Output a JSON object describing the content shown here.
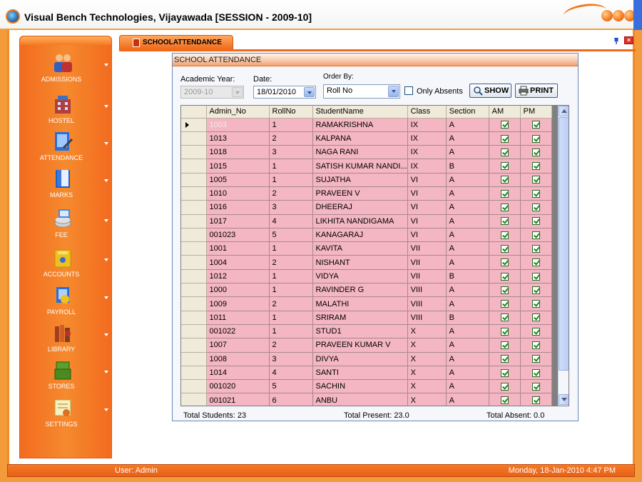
{
  "window": {
    "title": "Visual Bench Technologies, Vijayawada [SESSION - 2009-10]"
  },
  "sidebar": {
    "items": [
      {
        "label": "ADMISSIONS",
        "icon": "people-icon"
      },
      {
        "label": "HOSTEL",
        "icon": "building-icon"
      },
      {
        "label": "ATTENDANCE",
        "icon": "attendance-icon"
      },
      {
        "label": "MARKS",
        "icon": "book-icon"
      },
      {
        "label": "FEE",
        "icon": "coins-icon"
      },
      {
        "label": "ACCOUNTS",
        "icon": "ledger-icon"
      },
      {
        "label": "PAYROLL",
        "icon": "payroll-icon"
      },
      {
        "label": "LIBRARY",
        "icon": "library-icon"
      },
      {
        "label": "STORES",
        "icon": "stores-icon"
      },
      {
        "label": "SETTINGS",
        "icon": "settings-icon"
      }
    ]
  },
  "tab": {
    "label": "SCHOOLATTENDANCE"
  },
  "panel": {
    "header": "SCHOOL ATTENDANCE",
    "filters": {
      "academic_year_label": "Academic Year:",
      "academic_year_value": "2009-10",
      "date_label": "Date:",
      "date_value": "18/01/2010",
      "order_by_label": "Order By:",
      "order_by_value": "Roll No",
      "only_absents_label": "Only Absents"
    },
    "buttons": {
      "show": "SHOW",
      "print": "PRINT"
    },
    "grid": {
      "columns": [
        "Admin_No",
        "RollNo",
        "StudentName",
        "Class",
        "Section",
        "AM",
        "PM"
      ],
      "rows": [
        {
          "admin_no": "1003",
          "roll": "1",
          "name": "RAMAKRISHNA",
          "class": "IX",
          "section": "A",
          "am": true,
          "pm": true
        },
        {
          "admin_no": "1013",
          "roll": "2",
          "name": "KALPANA",
          "class": "IX",
          "section": "A",
          "am": true,
          "pm": true
        },
        {
          "admin_no": "1018",
          "roll": "3",
          "name": "NAGA RANI",
          "class": "IX",
          "section": "A",
          "am": true,
          "pm": true
        },
        {
          "admin_no": "1015",
          "roll": "1",
          "name": "SATISH KUMAR NANDI...",
          "class": "IX",
          "section": "B",
          "am": true,
          "pm": true
        },
        {
          "admin_no": "1005",
          "roll": "1",
          "name": "SUJATHA",
          "class": "VI",
          "section": "A",
          "am": true,
          "pm": true
        },
        {
          "admin_no": "1010",
          "roll": "2",
          "name": "PRAVEEN  V",
          "class": "VI",
          "section": "A",
          "am": true,
          "pm": true
        },
        {
          "admin_no": "1016",
          "roll": "3",
          "name": "DHEERAJ",
          "class": "VI",
          "section": "A",
          "am": true,
          "pm": true
        },
        {
          "admin_no": "1017",
          "roll": "4",
          "name": "LIKHITA  NANDIGAMA",
          "class": "VI",
          "section": "A",
          "am": true,
          "pm": true
        },
        {
          "admin_no": "001023",
          "roll": "5",
          "name": "KANAGARAJ",
          "class": "VI",
          "section": "A",
          "am": true,
          "pm": true
        },
        {
          "admin_no": "1001",
          "roll": "1",
          "name": "KAVITA",
          "class": "VII",
          "section": "A",
          "am": true,
          "pm": true
        },
        {
          "admin_no": "1004",
          "roll": "2",
          "name": "NISHANT",
          "class": "VII",
          "section": "A",
          "am": true,
          "pm": true
        },
        {
          "admin_no": "1012",
          "roll": "1",
          "name": "VIDYA",
          "class": "VII",
          "section": "B",
          "am": true,
          "pm": true
        },
        {
          "admin_no": "1000",
          "roll": "1",
          "name": "RAVINDER  G",
          "class": "VIII",
          "section": "A",
          "am": true,
          "pm": true
        },
        {
          "admin_no": "1009",
          "roll": "2",
          "name": "MALATHI",
          "class": "VIII",
          "section": "A",
          "am": true,
          "pm": true
        },
        {
          "admin_no": "1011",
          "roll": "1",
          "name": "SRIRAM",
          "class": "VIII",
          "section": "B",
          "am": true,
          "pm": true
        },
        {
          "admin_no": "001022",
          "roll": "1",
          "name": "STUD1",
          "class": "X",
          "section": "A",
          "am": true,
          "pm": true
        },
        {
          "admin_no": "1007",
          "roll": "2",
          "name": "PRAVEEN KUMAR V",
          "class": "X",
          "section": "A",
          "am": true,
          "pm": true
        },
        {
          "admin_no": "1008",
          "roll": "3",
          "name": "DIVYA",
          "class": "X",
          "section": "A",
          "am": true,
          "pm": true
        },
        {
          "admin_no": "1014",
          "roll": "4",
          "name": "SANTI",
          "class": "X",
          "section": "A",
          "am": true,
          "pm": true
        },
        {
          "admin_no": "001020",
          "roll": "5",
          "name": "SACHIN",
          "class": "X",
          "section": "A",
          "am": true,
          "pm": true
        },
        {
          "admin_no": "001021",
          "roll": "6",
          "name": "ANBU",
          "class": "X",
          "section": "A",
          "am": true,
          "pm": true
        }
      ]
    },
    "totals": {
      "students": "Total Students: 23",
      "present": "Total Present: 23.0",
      "absent": "Total Absent: 0.0"
    }
  },
  "statusbar": {
    "user": "User: Admin",
    "datetime": "Monday, 18-Jan-2010 4:47 PM"
  },
  "colors": {
    "accent": "#f36b1f",
    "row_bg": "#f4b6c2",
    "header_bg": "#efeada"
  }
}
